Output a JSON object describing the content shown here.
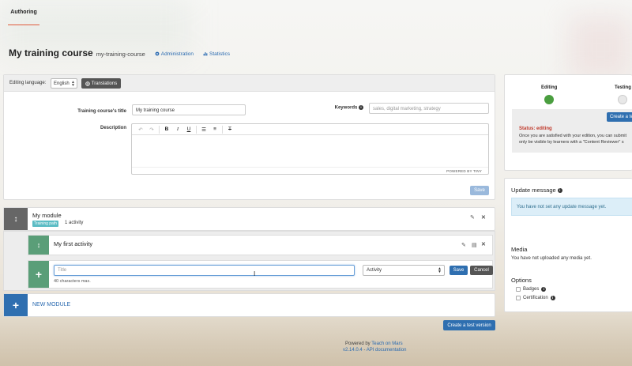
{
  "nav": {
    "tab_authoring": "Authoring"
  },
  "header": {
    "course_title": "My training course",
    "course_slug": "my-training-course",
    "administration_link": "Administration",
    "statistics_link": "Statistics"
  },
  "toolbar": {
    "editing_language_label": "Editing language:",
    "language_value": "English",
    "translations_button": "Translations"
  },
  "form": {
    "title_label": "Training course's title",
    "title_value": "My training course",
    "keywords_label": "Keywords",
    "keywords_placeholder": "sales, digital marketing, strategy",
    "description_label": "Description",
    "editor_footer": "POWERED BY TINY",
    "save_button": "Save"
  },
  "module": {
    "title": "My module",
    "badge": "Training path",
    "activity_count": "1 activity"
  },
  "activity": {
    "title": "My first activity"
  },
  "new_activity": {
    "title_placeholder": "Title",
    "chars_max": "40 characters max.",
    "type_value": "Activity",
    "save_button": "Save",
    "cancel_button": "Cancel"
  },
  "new_module_label": "NEW MODULE",
  "create_test_button": "Create a test version",
  "footer": {
    "powered_by_prefix": "Powered by",
    "powered_by_link": "Teach on Mars",
    "version": "v2.14.0.4",
    "separator": " - ",
    "api_link": "API documentation"
  },
  "sidebar": {
    "steps": [
      {
        "label": "Editing",
        "color": "#4a9e3f"
      },
      {
        "label": "Testing",
        "color": "#e8e8e8"
      }
    ],
    "create_test_button": "Create a test version",
    "status_label": "Status: editing",
    "status_text_line1": "Once you are satisfied with your edition, you can submit",
    "status_text_line2": "only be visible by learners with a \"Content Reviewer\" s",
    "update_message_title": "Update message",
    "update_message_text": "You have not set any update message yet.",
    "media_title": "Media",
    "media_text": "You have not uploaded any media yet.",
    "options_title": "Options",
    "options": [
      "Badges",
      "Certification"
    ]
  },
  "colors": {
    "primary": "#2f6fb0",
    "green": "#5a9e78",
    "accent_tab": "#e05a3c",
    "status_red": "#c0392b"
  }
}
